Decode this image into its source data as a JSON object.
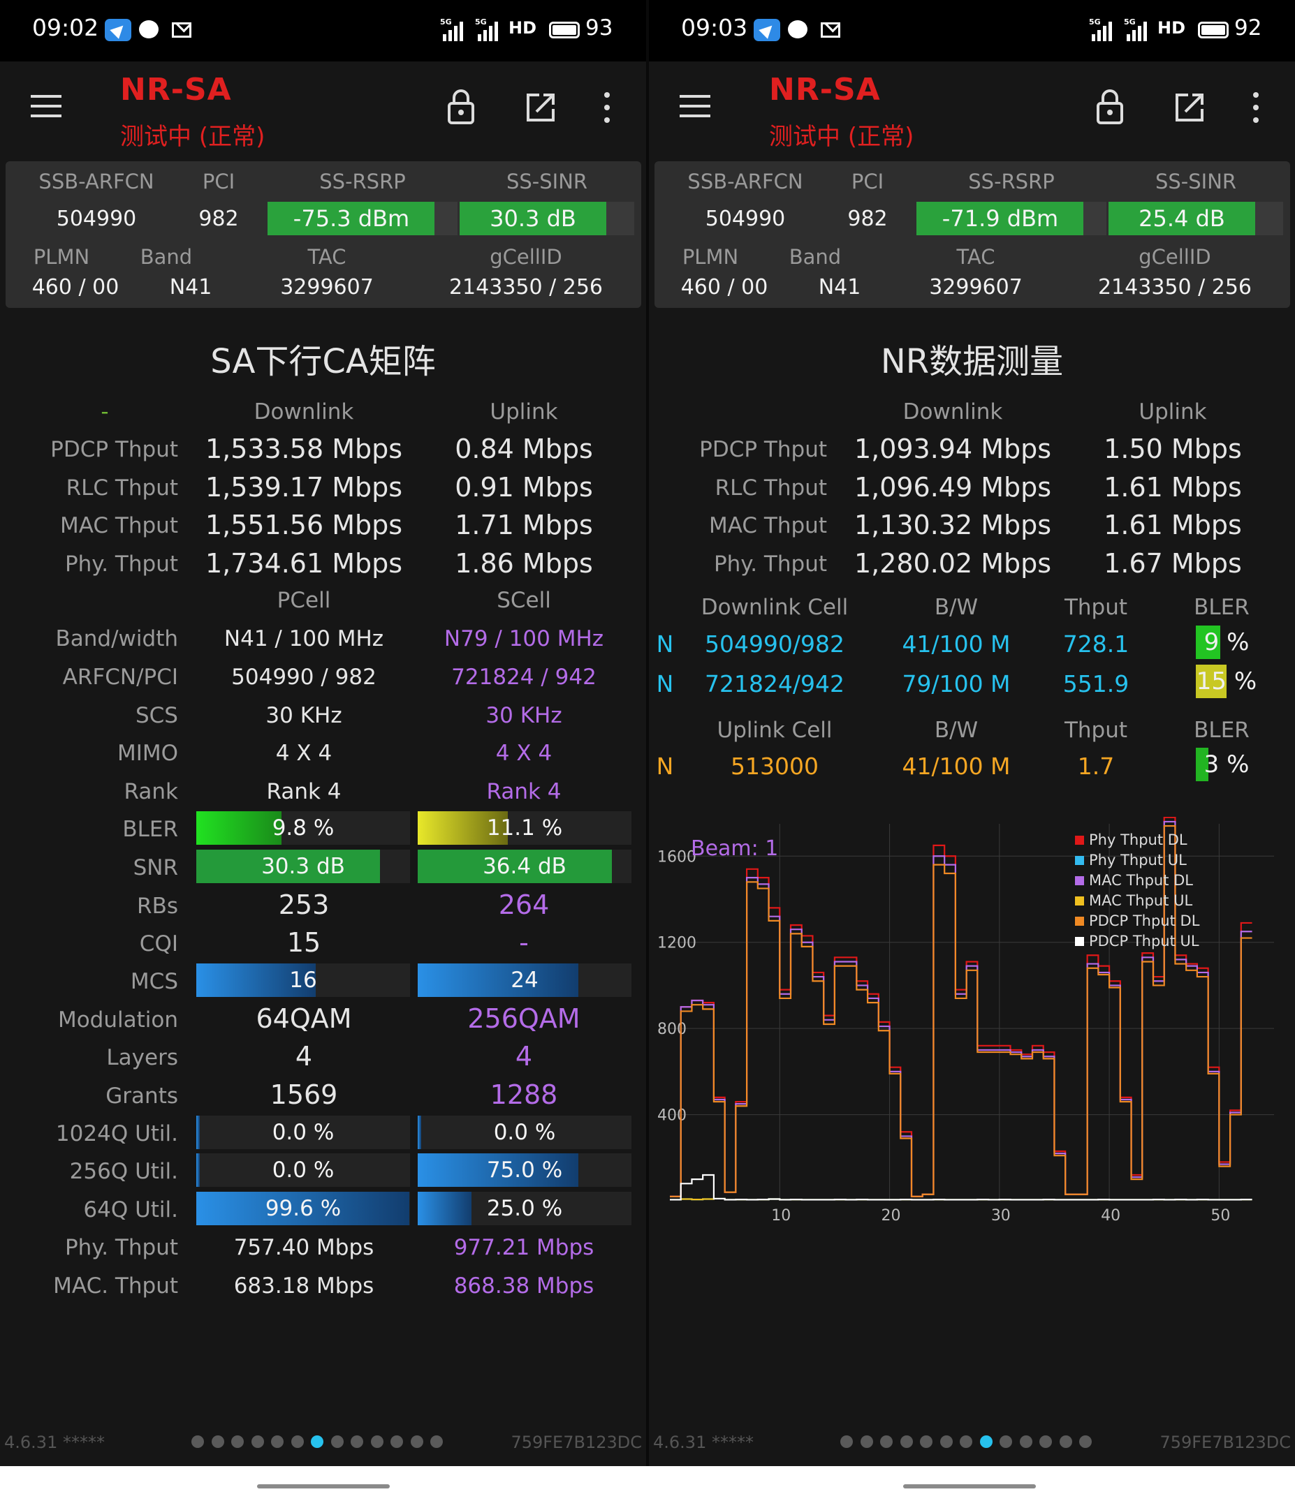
{
  "colors": {
    "title_red": "#e02020",
    "cell_green": "#2aa23c",
    "purple": "#b46ce8",
    "cyan": "#27c2ee",
    "orange": "#f5a623"
  },
  "left": {
    "status": {
      "time": "09:02",
      "signal1": "5G",
      "signal2": "5G",
      "hd": "HD",
      "battery": "93"
    },
    "appbar": {
      "title": "NR-SA",
      "subtitle": "测试中 (正常)",
      "icons": [
        "menu-icon",
        "lock-icon",
        "share-icon",
        "more-icon"
      ]
    },
    "cell": {
      "h1": "SSB-ARFCN",
      "h2": "PCI",
      "h3": "SS-RSRP",
      "h4": "SS-SINR",
      "arfcn": "504990",
      "pci": "982",
      "rsrp": "-75.3 dBm",
      "rsrp_level": 0.88,
      "sinr": "30.3 dB",
      "sinr_level": 0.84,
      "h5": "PLMN",
      "h6": "Band",
      "h7": "TAC",
      "h8": "gCellID",
      "plmn": "460 / 00",
      "band": "N41",
      "tac": "3299607",
      "gcellid": "2143350 / 256"
    },
    "section_title": "SA下行CA矩阵",
    "matrix": {
      "dash": "-",
      "col_dl": "Downlink",
      "col_ul": "Uplink",
      "thput_rows": [
        {
          "label": "PDCP Thput",
          "dl": "1,533.58 Mbps",
          "ul": "0.84 Mbps"
        },
        {
          "label": "RLC Thput",
          "dl": "1,539.17 Mbps",
          "ul": "0.91 Mbps"
        },
        {
          "label": "MAC Thput",
          "dl": "1,551.56 Mbps",
          "ul": "1.71 Mbps"
        },
        {
          "label": "Phy. Thput",
          "dl": "1,734.61 Mbps",
          "ul": "1.86 Mbps"
        }
      ],
      "col_pcell": "PCell",
      "col_scell": "SCell",
      "rows": [
        {
          "label": "Band/width",
          "p": "N41 / 100 MHz",
          "s": "N79 / 100 MHz"
        },
        {
          "label": "ARFCN/PCI",
          "p": "504990 / 982",
          "s": "721824 / 942"
        },
        {
          "label": "SCS",
          "p": "30 KHz",
          "s": "30 KHz"
        },
        {
          "label": "MIMO",
          "p": "4 X 4",
          "s": "4 X 4"
        },
        {
          "label": "Rank",
          "p": "Rank 4",
          "s": "Rank 4"
        }
      ],
      "bler": {
        "label": "BLER",
        "p": "9.8 %",
        "p_level": 0.4,
        "s": "11.1 %",
        "s_level": 0.42
      },
      "snr": {
        "label": "SNR",
        "p": "30.3 dB",
        "p_level": 0.86,
        "s": "36.4 dB",
        "s_level": 0.91
      },
      "rbs": {
        "label": "RBs",
        "p": "253",
        "s": "264"
      },
      "cqi": {
        "label": "CQI",
        "p": "15",
        "s": "-"
      },
      "mcs": {
        "label": "MCS",
        "p": "16",
        "p_level": 0.56,
        "s": "24",
        "s_level": 0.75
      },
      "modulation": {
        "label": "Modulation",
        "p": "64QAM",
        "s": "256QAM"
      },
      "layers": {
        "label": "Layers",
        "p": "4",
        "s": "4"
      },
      "grants": {
        "label": "Grants",
        "p": "1569",
        "s": "1288"
      },
      "util": [
        {
          "label": "1024Q Util.",
          "p": "0.0 %",
          "p_level": 0.0,
          "s": "0.0 %",
          "s_level": 0.0
        },
        {
          "label": "256Q Util.",
          "p": "0.0 %",
          "p_level": 0.0,
          "s": "75.0 %",
          "s_level": 0.75
        },
        {
          "label": "64Q Util.",
          "p": "99.6 %",
          "p_level": 0.996,
          "s": "25.0 %",
          "s_level": 0.25
        }
      ],
      "phy": {
        "label": "Phy. Thput",
        "p": "757.40 Mbps",
        "s": "977.21 Mbps"
      },
      "mac": {
        "label": "MAC. Thput",
        "p": "683.18 Mbps",
        "s": "868.38 Mbps"
      }
    },
    "footer": {
      "version": "4.6.31 *****",
      "id": "759FE7B123DC",
      "page_count": 13,
      "active_page": 6
    }
  },
  "right": {
    "status": {
      "time": "09:03",
      "signal1": "5G",
      "signal2": "5G",
      "hd": "HD",
      "battery": "92"
    },
    "appbar": {
      "title": "NR-SA",
      "subtitle": "测试中 (正常)"
    },
    "cell": {
      "h1": "SSB-ARFCN",
      "h2": "PCI",
      "h3": "SS-RSRP",
      "h4": "SS-SINR",
      "arfcn": "504990",
      "pci": "982",
      "rsrp": "-71.9 dBm",
      "rsrp_level": 0.88,
      "sinr": "25.4 dB",
      "sinr_level": 0.84,
      "h5": "PLMN",
      "h6": "Band",
      "h7": "TAC",
      "h8": "gCellID",
      "plmn": "460 / 00",
      "band": "N41",
      "tac": "3299607",
      "gcellid": "2143350 / 256"
    },
    "section_title": "NR数据测量",
    "measure": {
      "col_dl": "Downlink",
      "col_ul": "Uplink",
      "thput_rows": [
        {
          "label": "PDCP Thput",
          "dl": "1,093.94 Mbps",
          "ul": "1.50 Mbps"
        },
        {
          "label": "RLC Thput",
          "dl": "1,096.49 Mbps",
          "ul": "1.61 Mbps"
        },
        {
          "label": "MAC Thput",
          "dl": "1,130.32 Mbps",
          "ul": "1.61 Mbps"
        },
        {
          "label": "Phy. Thput",
          "dl": "1,280.02 Mbps",
          "ul": "1.67 Mbps"
        }
      ],
      "dl_cell_headers": [
        "Downlink Cell",
        "B/W",
        "Thput",
        "BLER"
      ],
      "dl_cells": [
        {
          "rat": "N",
          "cell": "504990/982",
          "bw": "41/100 M",
          "thput": "728.1",
          "bler": "9 %",
          "bler_level": 0.4,
          "bler_color": "#22c422"
        },
        {
          "rat": "N",
          "cell": "721824/942",
          "bw": "79/100 M",
          "thput": "551.9",
          "bler": "15 %",
          "bler_level": 0.5,
          "bler_color": "#c8c823"
        }
      ],
      "ul_cell_headers": [
        "Uplink Cell",
        "B/W",
        "Thput",
        "BLER"
      ],
      "ul_cells": [
        {
          "rat": "N",
          "cell": "513000",
          "bw": "41/100 M",
          "thput": "1.7",
          "bler": "3 %",
          "bler_level": 0.2,
          "bler_color": "#22b422"
        }
      ]
    },
    "footer": {
      "version": "4.6.31 *****",
      "id": "759FE7B123DC",
      "page_count": 13,
      "active_page": 7
    }
  },
  "chart_data": {
    "type": "line",
    "annotation": "Beam: 1",
    "x_ticks": [
      10,
      20,
      30,
      40,
      50
    ],
    "y_ticks": [
      400,
      800,
      1200,
      1600
    ],
    "xlim": [
      0,
      55
    ],
    "ylim": [
      0,
      1750
    ],
    "grid": true,
    "legend_position": "top-right",
    "series": [
      {
        "name": "Phy Thput DL",
        "color": "#e01818",
        "values": [
          20,
          900,
          930,
          920,
          480,
          40,
          460,
          1540,
          1500,
          1360,
          980,
          1280,
          1230,
          1060,
          860,
          1130,
          1130,
          1020,
          960,
          830,
          620,
          320,
          20,
          30,
          1650,
          1600,
          980,
          1110,
          720,
          720,
          720,
          700,
          680,
          720,
          690,
          230,
          30,
          30,
          1140,
          1090,
          1020,
          480,
          120,
          1150,
          1040,
          1780,
          1140,
          1100,
          1080,
          620,
          180,
          420,
          1290
        ]
      },
      {
        "name": "Phy Thput UL",
        "color": "#33bbf0",
        "values": [
          5,
          8,
          6,
          8,
          10,
          5,
          6,
          5,
          6,
          8,
          5,
          6,
          5,
          5,
          5,
          6,
          5,
          6,
          5,
          5,
          5,
          6,
          5,
          5,
          6,
          5,
          5,
          5,
          6,
          5,
          6,
          5,
          5,
          5,
          6,
          5,
          5,
          5,
          5,
          6,
          5,
          5,
          5,
          5,
          6,
          5,
          6,
          5,
          6,
          5,
          5,
          5,
          6
        ]
      },
      {
        "name": "MAC Thput DL",
        "color": "#b46ce8",
        "values": [
          20,
          900,
          930,
          910,
          470,
          40,
          450,
          1500,
          1470,
          1320,
          960,
          1260,
          1200,
          1040,
          840,
          1110,
          1110,
          1000,
          940,
          810,
          600,
          300,
          20,
          30,
          1600,
          1560,
          960,
          1090,
          700,
          700,
          700,
          690,
          670,
          700,
          670,
          220,
          30,
          30,
          1100,
          1060,
          1000,
          470,
          110,
          1130,
          1020,
          1760,
          1120,
          1090,
          1060,
          600,
          170,
          410,
          1250
        ]
      },
      {
        "name": "MAC Thput UL",
        "color": "#f0c020",
        "values": [
          5,
          8,
          6,
          8,
          10,
          5,
          6,
          5,
          6,
          8,
          5,
          6,
          5,
          5,
          5,
          6,
          5,
          6,
          5,
          5,
          5,
          6,
          5,
          5,
          6,
          5,
          5,
          5,
          6,
          5,
          6,
          5,
          5,
          5,
          6,
          5,
          5,
          5,
          5,
          6,
          5,
          5,
          5,
          5,
          6,
          5,
          6,
          5,
          6,
          5,
          5,
          5,
          6
        ]
      },
      {
        "name": "PDCP Thput DL",
        "color": "#f08a24",
        "values": [
          20,
          880,
          910,
          890,
          460,
          40,
          440,
          1480,
          1450,
          1300,
          940,
          1240,
          1180,
          1020,
          820,
          1090,
          1090,
          980,
          920,
          790,
          590,
          290,
          20,
          30,
          1560,
          1520,
          940,
          1070,
          690,
          690,
          690,
          680,
          660,
          690,
          660,
          210,
          30,
          30,
          1080,
          1050,
          990,
          460,
          100,
          1110,
          1000,
          1740,
          1100,
          1070,
          1040,
          590,
          160,
          400,
          1220
        ]
      },
      {
        "name": "PDCP Thput UL",
        "color": "#ffffff",
        "values": [
          5,
          80,
          100,
          120,
          10,
          5,
          6,
          5,
          6,
          8,
          5,
          6,
          5,
          5,
          5,
          6,
          5,
          6,
          5,
          5,
          5,
          6,
          5,
          5,
          6,
          5,
          5,
          5,
          6,
          5,
          6,
          5,
          5,
          5,
          6,
          5,
          5,
          5,
          5,
          6,
          5,
          5,
          5,
          5,
          6,
          5,
          6,
          5,
          6,
          5,
          5,
          5,
          6
        ]
      }
    ]
  }
}
